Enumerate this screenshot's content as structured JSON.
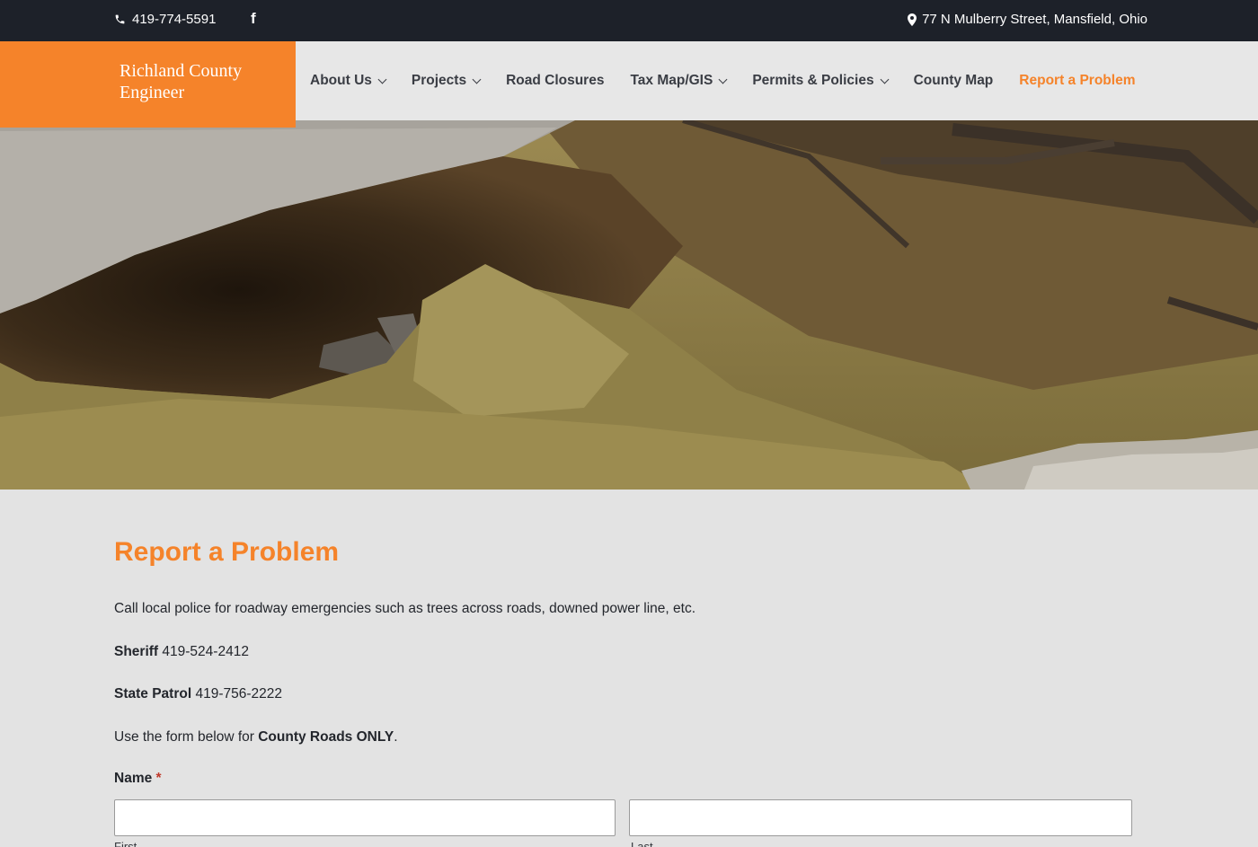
{
  "topbar": {
    "phone": "419-774-5591",
    "facebook_glyph": "f",
    "address": "77 N Mulberry Street, Mansfield, Ohio"
  },
  "logo": {
    "line1": "Richland County",
    "line2": "Engineer"
  },
  "nav": {
    "items": [
      {
        "label": "About Us",
        "has_dropdown": true
      },
      {
        "label": "Projects",
        "has_dropdown": true
      },
      {
        "label": "Road Closures",
        "has_dropdown": false
      },
      {
        "label": "Tax Map/GIS",
        "has_dropdown": true
      },
      {
        "label": "Permits & Policies",
        "has_dropdown": true
      },
      {
        "label": "County Map",
        "has_dropdown": false
      },
      {
        "label": "Report a Problem",
        "has_dropdown": false,
        "active": true
      }
    ]
  },
  "page": {
    "title": "Report a Problem",
    "intro": "Call local police for roadway emergencies such as trees across roads, downed power line, etc.",
    "sheriff_label": "Sheriff",
    "sheriff_phone": "419-524-2412",
    "patrol_label": "State Patrol",
    "patrol_phone": "419-756-2222",
    "form_note_prefix": "Use the form below for ",
    "form_note_bold": "County Roads ONLY",
    "form_note_suffix": "."
  },
  "form": {
    "name_label": "Name",
    "required_mark": "*",
    "first_value": "",
    "last_value": "",
    "first_sublabel": "First",
    "last_sublabel": "Last"
  },
  "colors": {
    "accent": "#f5832a",
    "topbar_bg": "#1d2129",
    "header_bg": "#e7e7e7",
    "page_bg": "#e3e3e3"
  }
}
